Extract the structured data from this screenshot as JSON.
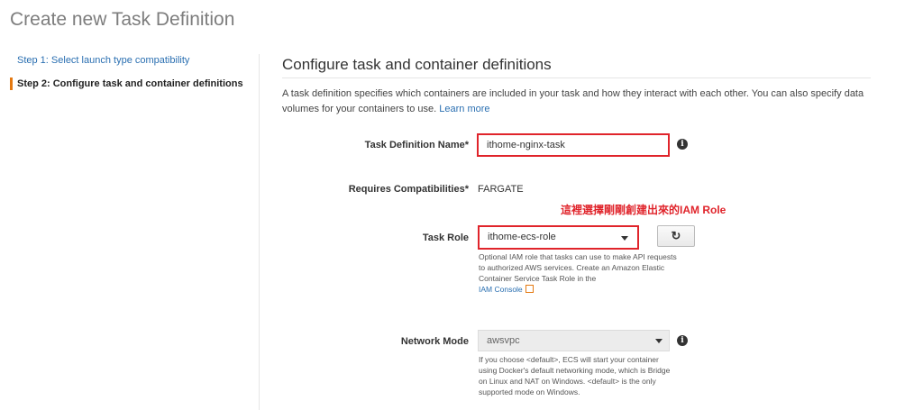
{
  "page_title": "Create new Task Definition",
  "steps": {
    "step1": "Step 1: Select launch type compatibility",
    "step2": "Step 2: Configure task and container definitions"
  },
  "section": {
    "title": "Configure task and container definitions",
    "description": "A task definition specifies which containers are included in your task and how they interact with each other. You can also specify data volumes for your containers to use.",
    "learn_more": "Learn more"
  },
  "fields": {
    "task_definition_name": {
      "label": "Task Definition Name*",
      "value": "ithome-nginx-task"
    },
    "requires_compatibilities": {
      "label": "Requires Compatibilities*",
      "value": "FARGATE"
    },
    "task_role": {
      "label": "Task Role",
      "value": "ithome-ecs-role",
      "help_text": "Optional IAM role that tasks can use to make API requests to authorized AWS services. Create an Amazon Elastic Container Service Task Role in the",
      "help_link": "IAM Console"
    },
    "network_mode": {
      "label": "Network Mode",
      "value": "awsvpc",
      "help_text": "If you choose <default>, ECS will start your container using Docker's default networking mode, which is Bridge on Linux and NAT on Windows. <default> is the only supported mode on Windows."
    }
  },
  "annotation": "這裡選擇剛剛創建出來的IAM Role",
  "icons": [
    "info-icon",
    "refresh-icon",
    "caret-down-icon",
    "external-link-icon"
  ],
  "colors": {
    "highlight": "#e0242b",
    "link": "#2a6fb1",
    "step_accent": "#e47911"
  }
}
